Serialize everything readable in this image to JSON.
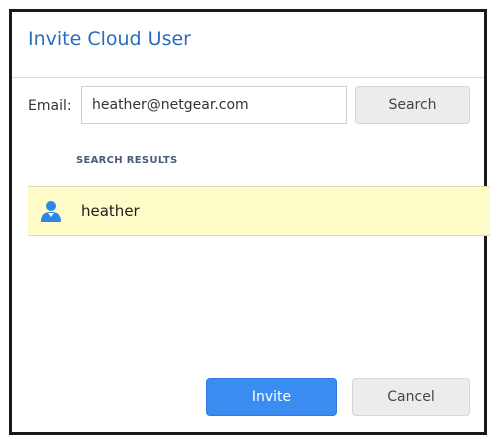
{
  "dialog": {
    "title": "Invite Cloud User"
  },
  "email": {
    "label": "Email:",
    "value": "heather@netgear.com",
    "search_button_label": "Search"
  },
  "results": {
    "heading": "SEARCH RESULTS",
    "items": [
      {
        "name": "heather",
        "icon": "user-icon"
      }
    ],
    "highlight_color": "#fdfbc7"
  },
  "actions": {
    "invite_label": "Invite",
    "cancel_label": "Cancel",
    "primary_color": "#3a8cf0"
  }
}
